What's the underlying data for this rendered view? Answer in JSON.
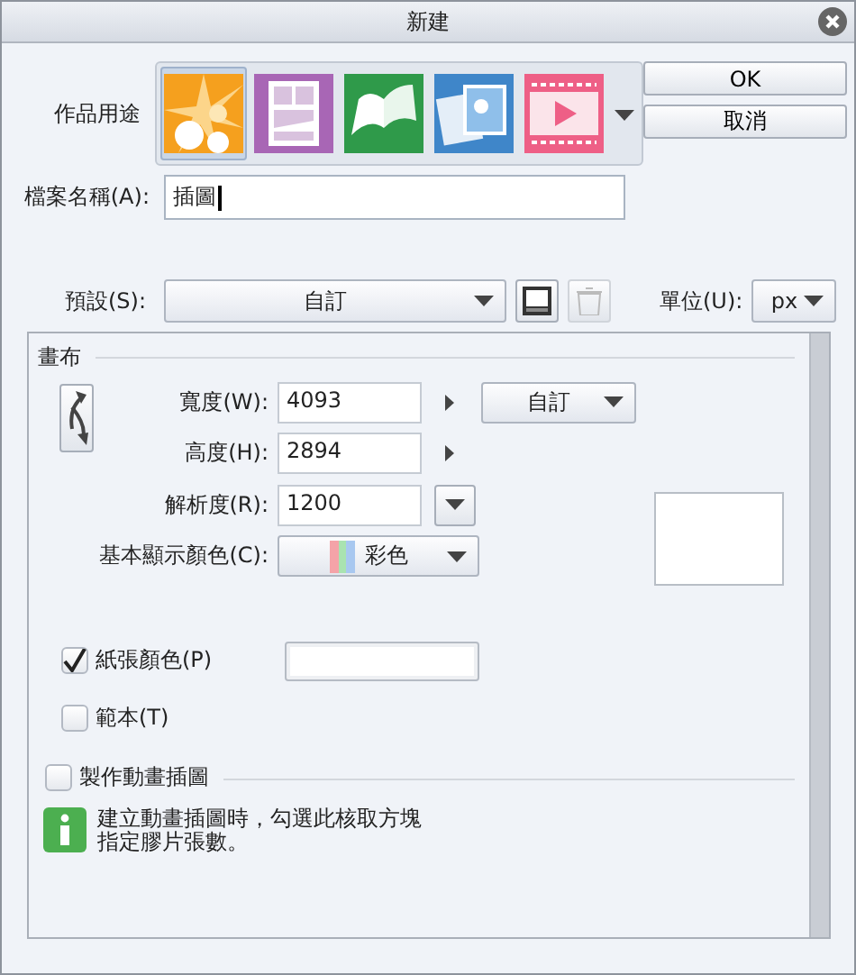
{
  "window": {
    "title": "新建"
  },
  "purpose": {
    "label": "作品用途",
    "options": [
      {
        "kind": "illustration",
        "selected": true
      },
      {
        "kind": "comic",
        "selected": false
      },
      {
        "kind": "book",
        "selected": false
      },
      {
        "kind": "photo",
        "selected": false
      },
      {
        "kind": "animation",
        "selected": false
      }
    ]
  },
  "buttons": [
    {
      "label": "OK"
    },
    {
      "label": "取消"
    }
  ],
  "file_name": {
    "label": "檔案名稱(A):",
    "value": "插圖"
  },
  "preset": {
    "label": "預設(S):",
    "value": "自訂",
    "tools": [
      {
        "kind": "save",
        "disabled": false
      },
      {
        "kind": "delete",
        "disabled": true
      }
    ]
  },
  "unit": {
    "label": "單位(U):",
    "value": "px"
  },
  "canvas": {
    "title": "畫布",
    "fields": [
      {
        "label": "寬度(W):",
        "value": "4093",
        "kind": "linked",
        "preset": "自訂"
      },
      {
        "label": "高度(H):",
        "value": "2894",
        "kind": "linked"
      },
      {
        "label": "解析度(R):",
        "value": "1200",
        "kind": "list"
      }
    ],
    "color_mode": {
      "label": "基本顯示顏色(C):",
      "value": "彩色"
    },
    "paper_color": {
      "label": "紙張顏色(P)",
      "checked": true
    },
    "template": {
      "label": "範本(T)",
      "checked": false
    }
  },
  "animation": {
    "label": "製作動畫插圖",
    "checked": false,
    "info_lines": [
      "建立動畫插圖時，勾選此核取方塊",
      "指定膠片張數。"
    ]
  }
}
